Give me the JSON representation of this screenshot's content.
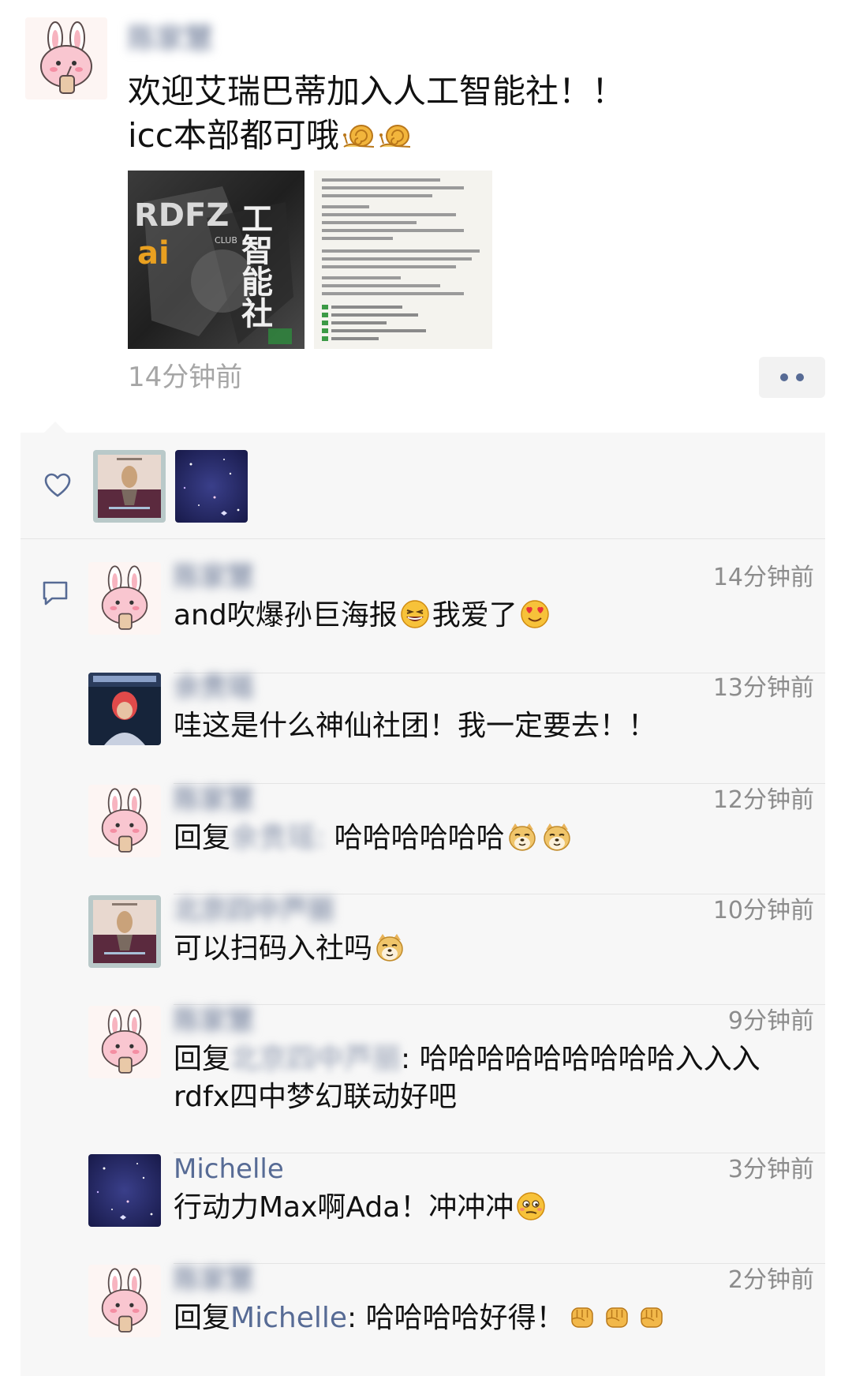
{
  "post": {
    "author": "陈家慧",
    "text_line1": "欢迎艾瑞巴蒂加入人工智能社！！",
    "text_line2": "icc本部都可哦",
    "line2_emojis": [
      "snail-emoji",
      "snail-emoji"
    ],
    "image1": {
      "text_top": "RDFZ",
      "text_bottom": "ai",
      "text_club": "CLUB",
      "title_vertical": "工智能社",
      "icon": "poster-image"
    },
    "image2": {
      "icon": "chat-screenshot-image"
    },
    "time": "14分钟前",
    "more_icon": "more-dots-icon"
  },
  "likes": {
    "icon": "heart-icon",
    "avatars": [
      "album-cover-avatar",
      "starry-night-avatar"
    ]
  },
  "comments_icon": "comment-bubble-icon",
  "comments": [
    {
      "name": "陈家慧",
      "name_blurred": true,
      "time": "14分钟前",
      "avatar": "bunny-avatar",
      "reply_label": "",
      "reply_to": "",
      "text": "and吹爆孙巨海报",
      "mid_emoji": "grinning-sweat-emoji",
      "text2": "我爱了",
      "end_emojis": [
        "heart-eyes-emoji"
      ]
    },
    {
      "name": "余贵瑶",
      "name_blurred": true,
      "time": "13分钟前",
      "avatar": "red-hair-avatar",
      "reply_label": "",
      "reply_to": "",
      "text": "哇这是什么神仙社团！我一定要去！！",
      "end_emojis": []
    },
    {
      "name": "陈家慧",
      "name_blurred": true,
      "time": "12分钟前",
      "avatar": "bunny-avatar",
      "reply_label": "回复",
      "reply_to": "余贵瑶:",
      "text": " 哈哈哈哈哈哈",
      "end_emojis": [
        "doge-emoji",
        "doge-emoji"
      ]
    },
    {
      "name": "北京四中芦丽",
      "name_blurred": true,
      "time": "10分钟前",
      "avatar": "album-cover-avatar",
      "reply_label": "",
      "reply_to": "",
      "text": "可以扫码入社吗",
      "end_emojis": [
        "doge-emoji"
      ]
    },
    {
      "name": "陈家慧",
      "name_blurred": true,
      "time": "9分钟前",
      "avatar": "bunny-avatar",
      "reply_label": "回复",
      "reply_to": "北京四中芦丽",
      "text": ": 哈哈哈哈哈哈哈哈哈入入入rdfx四中梦幻联动好吧",
      "end_emojis": []
    },
    {
      "name": "Michelle",
      "name_blurred": false,
      "time": "3分钟前",
      "avatar": "starry-night-avatar",
      "reply_label": "",
      "reply_to": "",
      "text": "行动力Max啊Ada！冲冲冲",
      "end_emojis": [
        "smirk-emoji"
      ]
    },
    {
      "name": "陈家慧",
      "name_blurred": true,
      "time": "2分钟前",
      "avatar": "bunny-avatar",
      "reply_label": "回复",
      "reply_to": "Michelle",
      "text": ": 哈哈哈哈好得！",
      "end_emojis": [
        "fist-emoji",
        "fist-emoji",
        "fist-emoji"
      ]
    }
  ],
  "colors": {
    "link": "#576b95",
    "panel": "#f7f7f7",
    "time": "#a6a6a6"
  }
}
